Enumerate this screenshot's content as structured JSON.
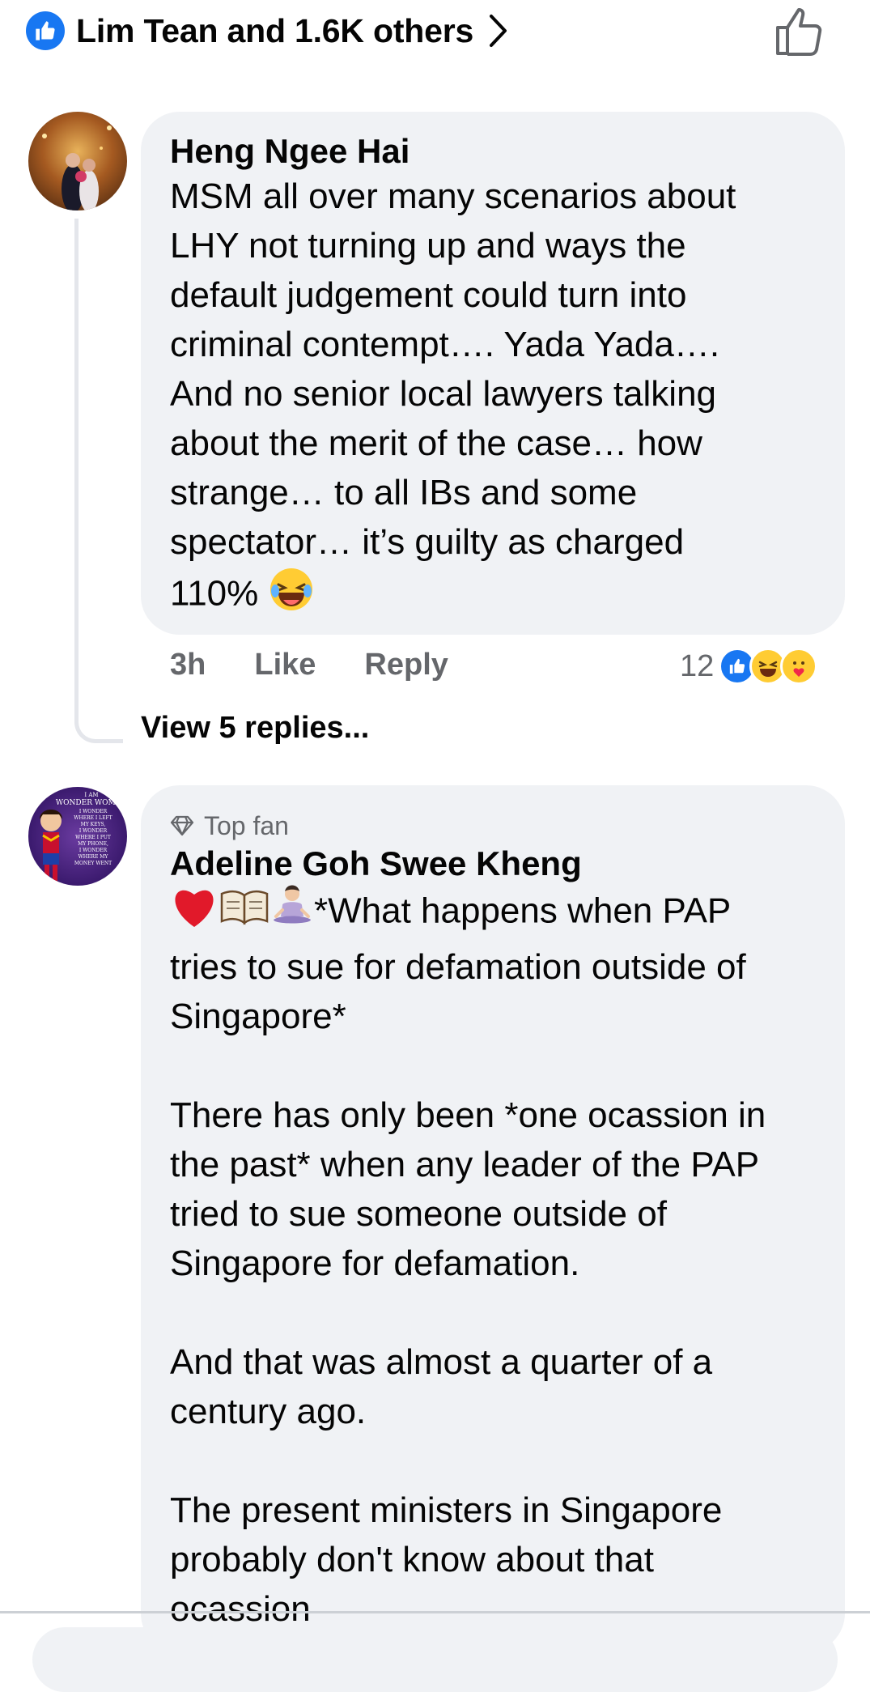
{
  "reactions_bar": {
    "summary": "Lim Tean and 1.6K others"
  },
  "comments": [
    {
      "author": "Heng Ngee Hai",
      "text": "MSM all over many scenarios about LHY not turning up and ways the default judgement could turn into criminal contempt…. Yada Yada…. And no senior local lawyers talking about the merit of the case… how strange… to all IBs and some spectator… it’s guilty as charged 110%",
      "lines": [
        "MSM all over many scenarios about",
        "LHY not turning up and ways the",
        "default judgement could turn into",
        "criminal contempt…. Yada Yada….",
        "And no senior local lawyers talking",
        "about the merit of the case… how",
        "strange… to all IBs and some",
        "spectator… it’s guilty as charged",
        "110%"
      ],
      "time": "3h",
      "like_label": "Like",
      "reply_label": "Reply",
      "reaction_count": "12",
      "view_replies": "View 5 replies..."
    },
    {
      "badge": "Top fan",
      "author": "Adeline Goh Swee Kheng",
      "lines": [
        "*What happens when PAP",
        "tries to sue for defamation outside of",
        "Singapore*",
        "",
        "There has only been *one ocassion in",
        "the past* when any leader of the PAP",
        "tried to sue someone outside of",
        "Singapore for defamation.",
        "",
        "And that was almost a quarter of a",
        "century ago.",
        "",
        "The present ministers in Singapore",
        "probably don't know about that",
        "ocassion"
      ]
    }
  ],
  "avatar2_text": [
    "I AM",
    "WONDER WOMAN",
    "I WONDER",
    "WHERE I LEFT",
    "MY KEYS,",
    "I WONDER",
    "WHERE I PUT",
    "MY PHONE,",
    "I WONDER",
    "WHERE MY",
    "MONEY WENT"
  ],
  "colors": {
    "accent": "#1877f2",
    "bubble": "#f0f2f5",
    "secondary_text": "#65676b"
  },
  "icons": [
    "like-icon",
    "chevron-right-icon",
    "like-outline-icon",
    "haha-emoji-icon",
    "care-emoji-icon",
    "heart-icon",
    "book-icon",
    "meditating-person-icon",
    "diamond-icon"
  ]
}
